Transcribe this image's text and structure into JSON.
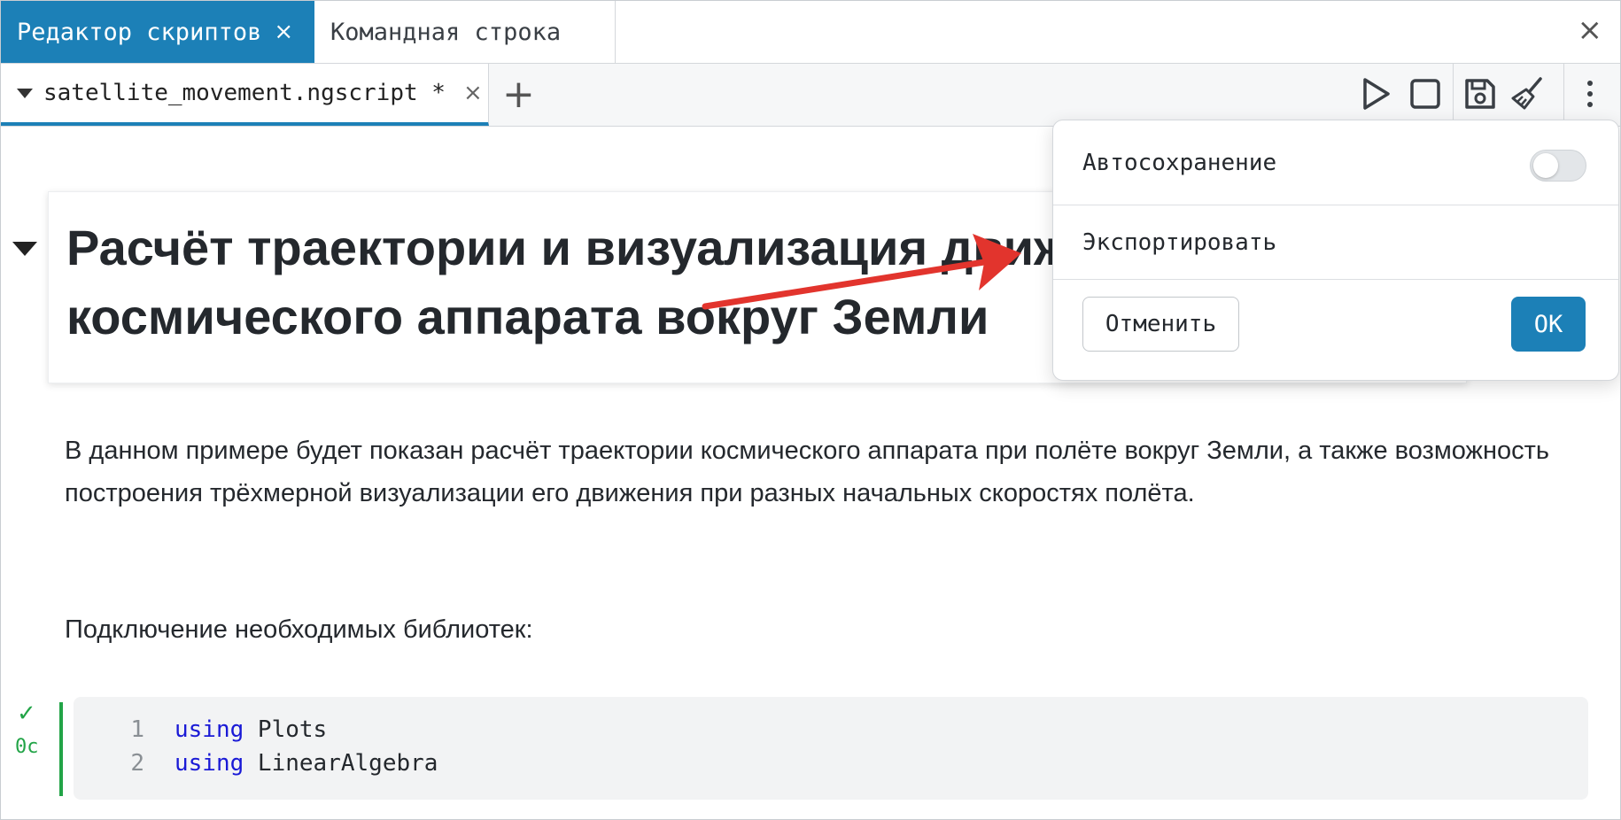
{
  "panel_tabs": {
    "active": {
      "label": "Редактор скриптов",
      "close": "×"
    },
    "inactive": {
      "label": "Командная строка"
    },
    "close": "×"
  },
  "file_tab": {
    "name": "satellite_movement.ngscript *",
    "close": "×"
  },
  "toolbar": {
    "add_tab": "+",
    "icons": [
      "play-icon",
      "stop-icon",
      "save-icon",
      "broom-icon",
      "more-vertical-icon"
    ]
  },
  "document": {
    "heading": "Расчёт траектории и визуализация движения космического аппарата вокруг Земли",
    "paragraph": "В данном примере будет показан расчёт траектории космического аппарата при полёте вокруг Земли, а также возможность построения трёхмерной визуализации его движения при разных начальных скоростях полёта.",
    "paragraph2": "Подключение необходимых библиотек:"
  },
  "code_cell": {
    "status_icon": "check-icon",
    "status_check": "✓",
    "duration": "0с",
    "lines": [
      {
        "number": "1",
        "keyword": "using",
        "rest": " Plots"
      },
      {
        "number": "2",
        "keyword": "using",
        "rest": " LinearAlgebra"
      }
    ]
  },
  "menu": {
    "autosave_label": "Автосохранение",
    "autosave_enabled": false,
    "export_label": "Экспортировать",
    "cancel_label": "Отменить",
    "ok_label": "OK"
  },
  "colors": {
    "accent": "#1c80b7",
    "success": "#22a447",
    "annotation_arrow": "#e2342d",
    "keyword": "#1a1ad6"
  }
}
